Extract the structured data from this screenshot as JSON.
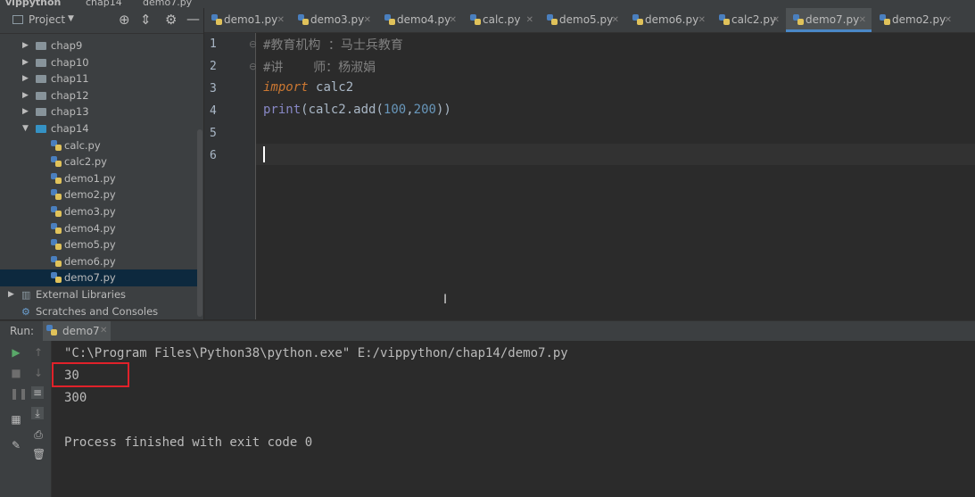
{
  "breadcrumbs": [
    "vippython",
    "chap14",
    "demo7.py"
  ],
  "project_panel": {
    "title": "Project",
    "tree": [
      {
        "label": "chap9",
        "type": "folder",
        "expanded": false
      },
      {
        "label": "chap10",
        "type": "folder",
        "expanded": false
      },
      {
        "label": "chap11",
        "type": "folder",
        "expanded": false
      },
      {
        "label": "chap12",
        "type": "folder",
        "expanded": false
      },
      {
        "label": "chap13",
        "type": "folder",
        "expanded": false
      },
      {
        "label": "chap14",
        "type": "folder",
        "expanded": true
      },
      {
        "label": "calc.py",
        "type": "file"
      },
      {
        "label": "calc2.py",
        "type": "file"
      },
      {
        "label": "demo1.py",
        "type": "file"
      },
      {
        "label": "demo2.py",
        "type": "file"
      },
      {
        "label": "demo3.py",
        "type": "file"
      },
      {
        "label": "demo4.py",
        "type": "file"
      },
      {
        "label": "demo5.py",
        "type": "file"
      },
      {
        "label": "demo6.py",
        "type": "file"
      },
      {
        "label": "demo7.py",
        "type": "file",
        "selected": true
      },
      {
        "label": "External Libraries",
        "type": "library"
      },
      {
        "label": "Scratches and Consoles",
        "type": "scratch"
      }
    ]
  },
  "tabs": [
    {
      "label": "demo1.py"
    },
    {
      "label": "demo3.py"
    },
    {
      "label": "demo4.py"
    },
    {
      "label": "calc.py"
    },
    {
      "label": "demo5.py"
    },
    {
      "label": "demo6.py"
    },
    {
      "label": "calc2.py"
    },
    {
      "label": "demo7.py",
      "active": true
    },
    {
      "label": "demo2.py"
    }
  ],
  "editor": {
    "line_numbers": [
      "1",
      "2",
      "3",
      "4",
      "5",
      "6"
    ],
    "line1": "#教育机构 ：马士兵教育",
    "line2": "#讲    师：杨淑娟",
    "line3_kw": "import",
    "line3_mod": "calc2",
    "line4_fn": "print",
    "line4_a": "(calc2.",
    "line4_b": "add",
    "line4_c": "(",
    "line4_n1": "100",
    "line4_comma": ",",
    "line4_n2": "200",
    "line4_d": "))"
  },
  "run": {
    "label": "Run:",
    "config": "demo7",
    "output": [
      "\"C:\\Program Files\\Python38\\python.exe\" E:/vippython/chap14/demo7.py",
      "30",
      "300",
      "",
      "Process finished with exit code 0"
    ]
  },
  "colors": {
    "highlight_box": "#e0212a",
    "active_tab_underline": "#4a88c7",
    "keyword": "#cc7832",
    "number": "#6897bb"
  }
}
